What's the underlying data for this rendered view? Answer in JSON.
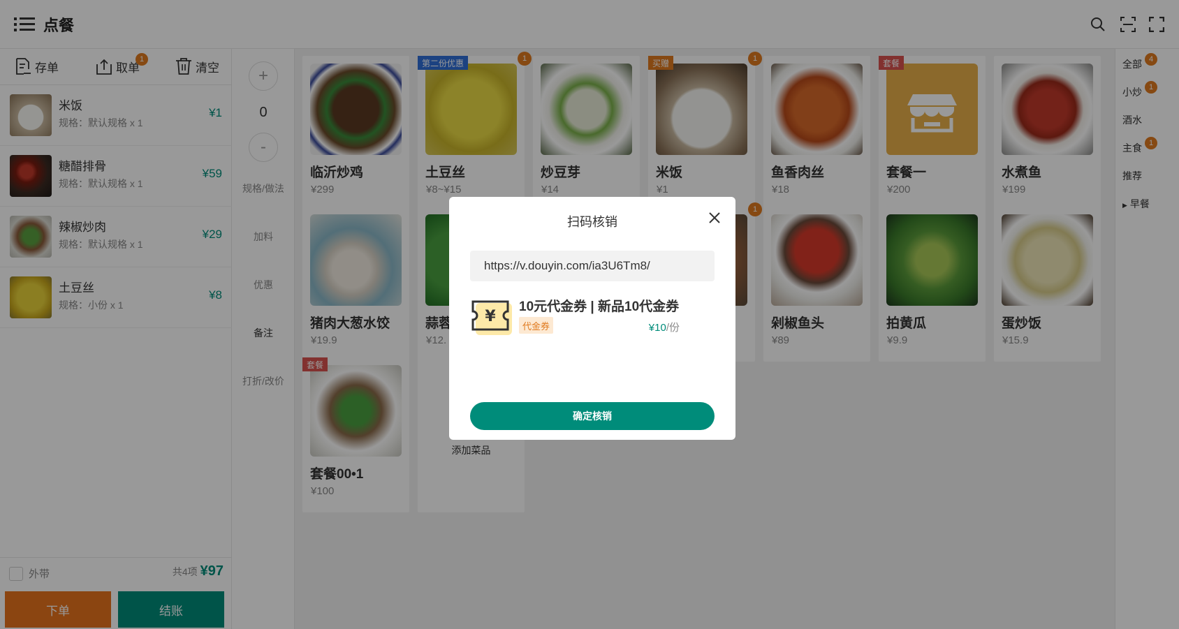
{
  "header": {
    "title": "点餐",
    "icons": [
      "menu-icon",
      "search-icon",
      "scan-icon",
      "fullscreen-icon"
    ]
  },
  "toolbar": {
    "save_label": "存单",
    "retrieve_label": "取单",
    "retrieve_badge": "1",
    "clear_label": "清空"
  },
  "order": {
    "items": [
      {
        "name": "米饭",
        "spec": "规格：默认规格 x 1",
        "price": "¥1"
      },
      {
        "name": "糖醋排骨",
        "spec": "规格：默认规格 x 1",
        "price": "¥59"
      },
      {
        "name": "辣椒炒肉",
        "spec": "规格：默认规格 x 1",
        "price": "¥29"
      },
      {
        "name": "土豆丝",
        "spec": "规格：小份 x 1",
        "price": "¥8"
      }
    ],
    "takeaway_label": "外带",
    "count_label": "共4项",
    "total": "¥97",
    "place_order_label": "下单",
    "checkout_label": "结账"
  },
  "controls": {
    "plus": "+",
    "minus": "-",
    "quantity": "0",
    "labels": [
      "规格/做法",
      "加料",
      "优惠",
      "备注",
      "打折/改价"
    ]
  },
  "products": [
    {
      "name": "临沂炒鸡",
      "price": "¥299",
      "tag": "",
      "badge": ""
    },
    {
      "name": "土豆丝",
      "price": "¥8~¥15",
      "tag": "第二份优惠",
      "badge": "1"
    },
    {
      "name": "炒豆芽",
      "price": "¥14",
      "tag": "",
      "badge": ""
    },
    {
      "name": "米饭",
      "price": "¥1",
      "tag": "买赠",
      "badge": "1"
    },
    {
      "name": "鱼香肉丝",
      "price": "¥18",
      "tag": "",
      "badge": ""
    },
    {
      "name": "套餐一",
      "price": "¥200",
      "tag": "套餐",
      "badge": ""
    },
    {
      "name": "水煮鱼",
      "price": "¥199",
      "tag": "",
      "badge": ""
    },
    {
      "name": "猪肉大葱水饺",
      "price": "¥19.9",
      "tag": "",
      "badge": ""
    },
    {
      "name": "蒜蓉",
      "price": "¥12.",
      "tag": "",
      "badge": ""
    },
    {
      "name": "",
      "price": "",
      "tag": "",
      "badge": "1"
    },
    {
      "name": "剁椒鱼头",
      "price": "¥89",
      "tag": "",
      "badge": ""
    },
    {
      "name": "拍黄瓜",
      "price": "¥9.9",
      "tag": "",
      "badge": ""
    },
    {
      "name": "蛋炒饭",
      "price": "¥15.9",
      "tag": "",
      "badge": ""
    },
    {
      "name": "套餐00•1",
      "price": "¥100",
      "tag": "套餐",
      "badge": ""
    }
  ],
  "add_product_label": "添加菜品",
  "categories": [
    {
      "name": "全部",
      "badge": "4"
    },
    {
      "name": "小炒",
      "badge": "1"
    },
    {
      "name": "酒水",
      "badge": ""
    },
    {
      "name": "主食",
      "badge": "1"
    },
    {
      "name": "推荐",
      "badge": ""
    },
    {
      "name": "早餐",
      "badge": ""
    }
  ],
  "modal": {
    "title": "扫码核销",
    "url_value": "https://v.douyin.com/ia3U6Tm8/",
    "coupon": {
      "name": "10元代金券 | 新品10代金券",
      "tag": "代金券",
      "price": "¥10",
      "unit": "/份"
    },
    "confirm_label": "确定核销"
  },
  "colors": {
    "primary": "#008c7a",
    "accent": "#e8731d",
    "badge": "#e07a1f"
  }
}
